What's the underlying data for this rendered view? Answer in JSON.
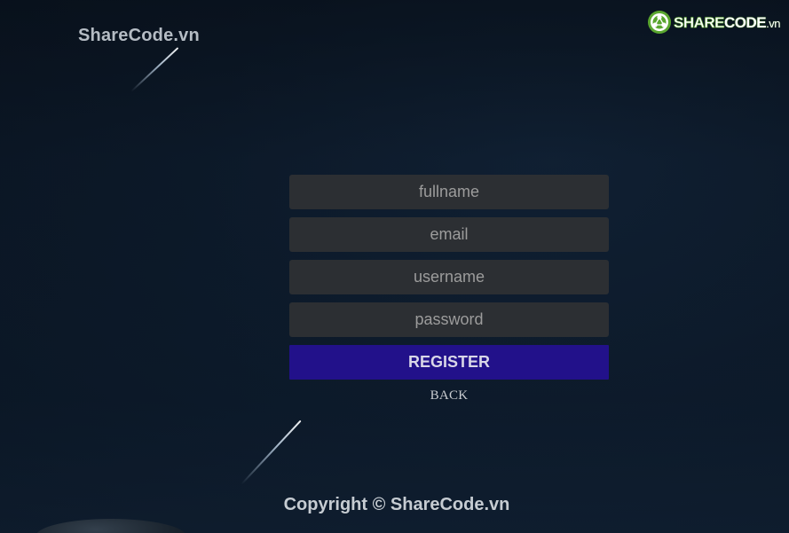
{
  "header": {
    "brand_text": "ShareCode.vn",
    "logo": {
      "text_part1": "SHARE",
      "text_part2": "CODE",
      "text_part3": ".vn",
      "icon": "sharecode-logo-icon",
      "color": "#5aa62f"
    }
  },
  "form": {
    "fullname_placeholder": "fullname",
    "email_placeholder": "email",
    "username_placeholder": "username",
    "password_placeholder": "password",
    "register_label": "REGISTER",
    "back_label": "BACK",
    "register_color": "#22118a"
  },
  "footer": {
    "copyright": "Copyright © ShareCode.vn"
  }
}
